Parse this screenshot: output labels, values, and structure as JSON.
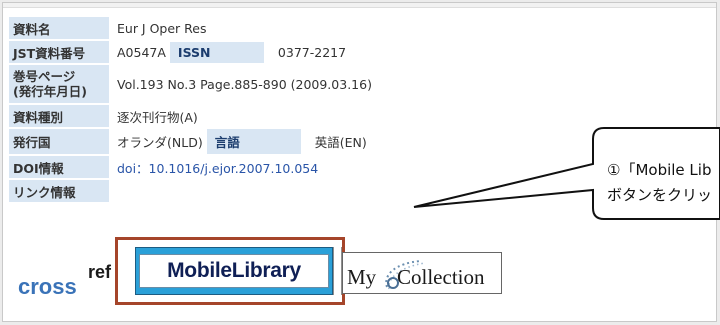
{
  "fields": {
    "journal_label": "資料名",
    "journal_value": "Eur J Oper Res",
    "jst_label": "JST資料番号",
    "jst_value": "A0547A",
    "issn_label": "ISSN",
    "issn_value": "0377-2217",
    "volume_label_1": "巻号ページ",
    "volume_label_2": "(発行年月日)",
    "volume_value": "Vol.193 No.3 Page.885-890 (2009.03.16)",
    "doc_type_label": "資料種別",
    "doc_type_value": "逐次刊行物(A)",
    "country_label": "発行国",
    "country_value": "オランダ(NLD)",
    "language_label": "言語",
    "language_value": "英語(EN)",
    "doi_label": "DOI情報",
    "doi_value": "doi：10.1016/j.ejor.2007.10.054",
    "link_label": "リンク情報"
  },
  "links": {
    "crossref_cross": "cross",
    "crossref_ref": "ref",
    "mobile_library": "MobileLibrary",
    "my": "My",
    "collection": "Collection"
  },
  "callout": {
    "line1": "①「Mobile Lib",
    "line2": "ボタンをクリッ"
  },
  "colors": {
    "label_bg": "#d9e6f3",
    "label_text": "#1c3d6e",
    "doi_link": "#2a55a8",
    "highlight_border": "#a5452a",
    "mobile_library_bg": "#2aa0d8"
  }
}
